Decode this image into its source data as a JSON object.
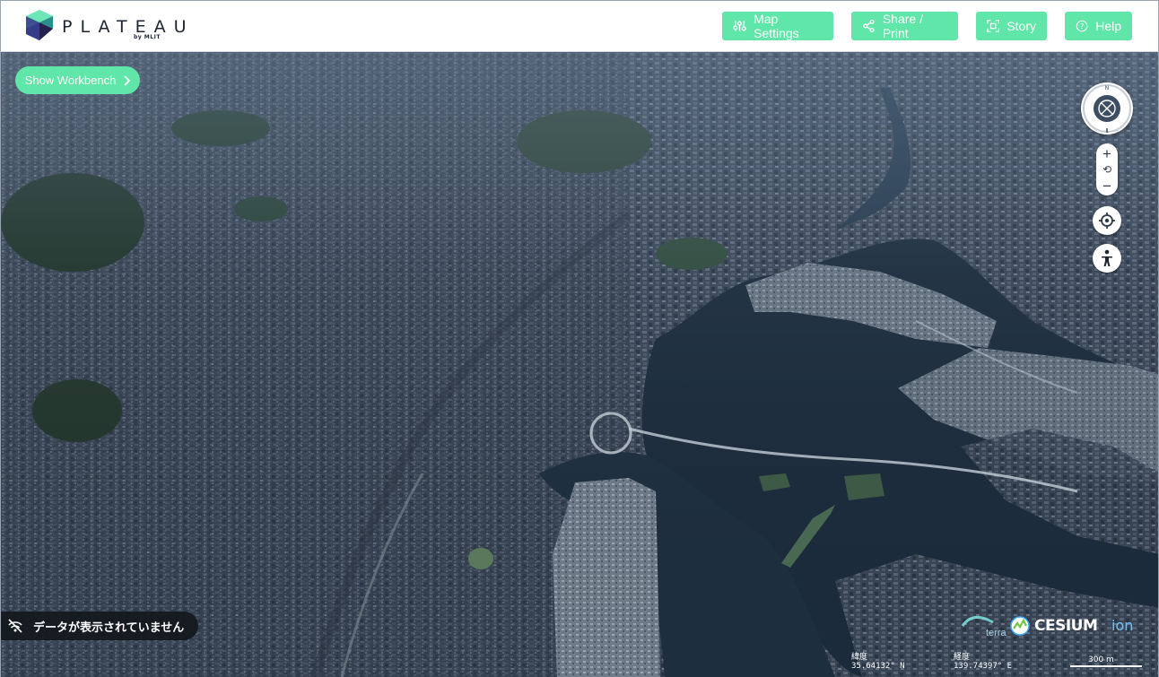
{
  "header": {
    "logo_text": "PLATEAU",
    "logo_sub": "by MLIT",
    "buttons": {
      "map_settings": "Map Settings",
      "share_print": "Share / Print",
      "story": "Story",
      "help": "Help"
    }
  },
  "map": {
    "workbench_button": "Show Workbench",
    "compass_north": "N",
    "zoom": {
      "in": "+",
      "reset": "⟲",
      "out": "−"
    },
    "notice": "データが表示されていません",
    "credits": {
      "cesium": "CESIUM",
      "ion": "ion",
      "terra": "terra"
    },
    "coordinates": {
      "lat_label": "緯度",
      "lat_value": "35.64132° N",
      "lon_label": "経度",
      "lon_value": "139.74397° E"
    },
    "scale": "300 m"
  },
  "colors": {
    "accent": "#5fe6a8",
    "header_bg": "#ffffff",
    "water": "#1b2b3b",
    "city": "#3e4c5c"
  },
  "icons": [
    "sliders-icon",
    "share-icon",
    "story-icon",
    "help-icon",
    "chevron-right-icon",
    "compass-icon",
    "locate-icon",
    "pedestrian-icon",
    "no-data-icon"
  ]
}
